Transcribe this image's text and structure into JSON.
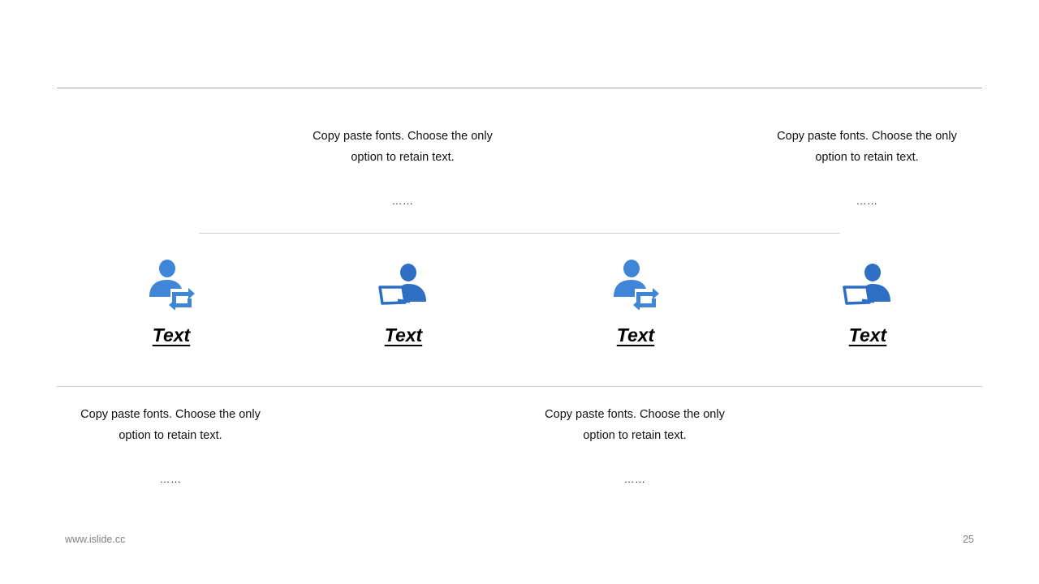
{
  "top_items": [
    {
      "desc": "Copy paste fonts. Choose the only option to retain text.",
      "dots": "……"
    },
    {
      "desc": "Copy paste fonts. Choose the only option to retain text.",
      "dots": "……"
    }
  ],
  "bottom_items": [
    {
      "desc": "Copy paste fonts. Choose the only option to retain text.",
      "dots": "……"
    },
    {
      "desc": "Copy paste fonts. Choose the only option to retain text.",
      "dots": "……"
    }
  ],
  "icons": [
    {
      "name": "user-sync-icon",
      "label": "Text"
    },
    {
      "name": "user-tablet-icon",
      "label": "Text"
    },
    {
      "name": "user-sync-icon",
      "label": "Text"
    },
    {
      "name": "user-tablet-icon",
      "label": "Text"
    }
  ],
  "colors": {
    "icon_light": "#3f86d9",
    "icon_dark": "#2e6fc4"
  },
  "footer": {
    "url": "www.islide.cc",
    "page": "25"
  }
}
